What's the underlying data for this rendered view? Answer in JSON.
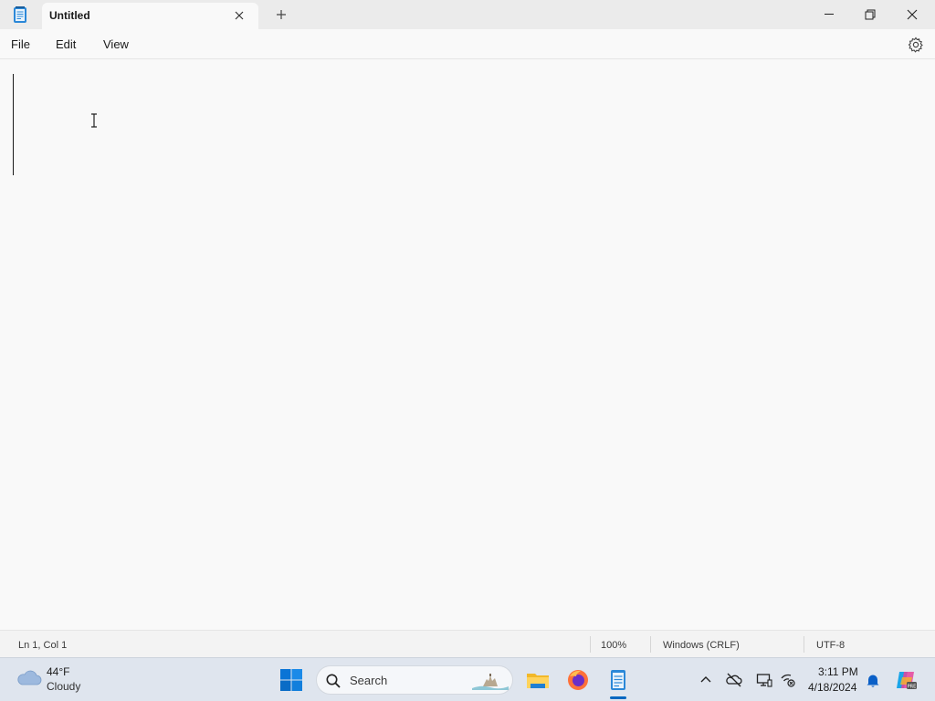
{
  "window": {
    "tab_title": "Untitled",
    "app_icon": "notepad-icon"
  },
  "menu": {
    "file": "File",
    "edit": "Edit",
    "view": "View",
    "settings_icon": "gear-icon"
  },
  "editor": {
    "content": ""
  },
  "status": {
    "position": "Ln 1, Col 1",
    "zoom": "100%",
    "line_ending": "Windows (CRLF)",
    "encoding": "UTF-8"
  },
  "taskbar": {
    "weather": {
      "temp": "44°F",
      "condition": "Cloudy",
      "icon": "cloud-icon"
    },
    "search_placeholder": "Search",
    "apps": [
      "file-explorer-icon",
      "firefox-icon",
      "notepad-icon"
    ],
    "clock": {
      "time": "3:11 PM",
      "date": "4/18/2024"
    }
  },
  "colors": {
    "accent": "#0067c0",
    "taskbar": "#dfe5ee",
    "titlebar": "#ebebeb",
    "editor_bg": "#f9f9f9"
  }
}
